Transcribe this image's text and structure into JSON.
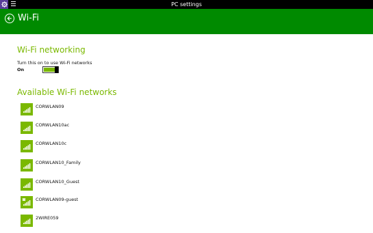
{
  "titlebar": {
    "app_title": "PC settings",
    "icons": [
      "gear-icon",
      "hamburger-menu-icon"
    ],
    "gear_bg": "#5a3e99"
  },
  "header": {
    "title": "Wi-Fi",
    "bg_color": "#008a00",
    "back_icon": "back-arrow-icon"
  },
  "wifi_networking": {
    "section_title": "Wi-Fi networking",
    "description": "Turn this on to use Wi-Fi networks",
    "toggle_state_label": "On",
    "toggle_on": true
  },
  "available": {
    "section_title": "Available Wi-Fi networks",
    "networks": [
      {
        "name": "CORWLAN09",
        "icon": "wifi-signal-icon"
      },
      {
        "name": "CORWLAN10ac",
        "icon": "wifi-signal-icon"
      },
      {
        "name": "CORWLAN10c",
        "icon": "wifi-signal-icon"
      },
      {
        "name": "CORWLAN10_Family",
        "icon": "wifi-signal-icon"
      },
      {
        "name": "CORWLAN10_Guest",
        "icon": "wifi-signal-icon"
      },
      {
        "name": "CORWLAN09-guest",
        "icon": "wifi-signal-unsecured-icon"
      },
      {
        "name": "2WIRE059",
        "icon": "wifi-signal-icon"
      }
    ]
  },
  "colors": {
    "accent_green": "#7ab800",
    "header_green": "#008a00"
  }
}
